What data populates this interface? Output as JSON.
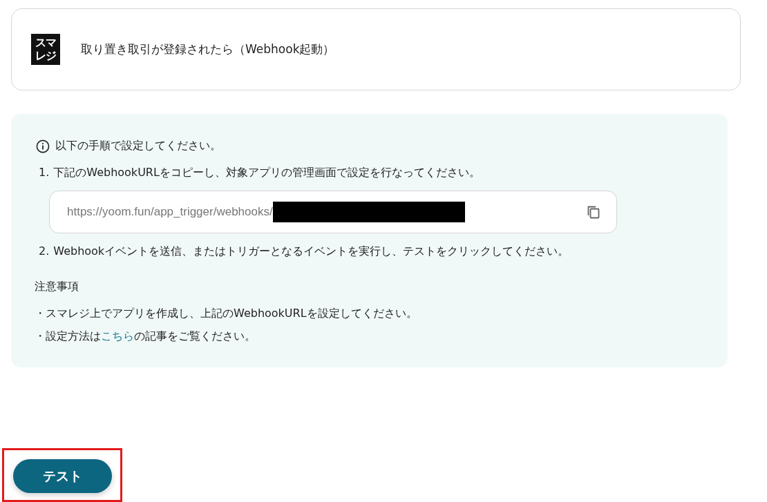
{
  "trigger": {
    "logo_text": "スマレジ",
    "title": "取り置き取引が登録されたら（Webhook起動）"
  },
  "instructions": {
    "heading": "以下の手順で設定してください。",
    "steps": [
      {
        "kind": "text",
        "number": "1.",
        "text": "下記のWebhookURLをコピーし、対象アプリの管理画面で設定を行なってください。"
      },
      {
        "kind": "url",
        "value": "https://yoom.fun/app_trigger/webhooks/",
        "redacted": true
      },
      {
        "kind": "text",
        "number": "2.",
        "text": "Webhookイベントを送信、またはトリガーとなるイベントを実行し、テストをクリックしてください。"
      }
    ],
    "notes_title": "注意事項",
    "notes": [
      {
        "text_before": "・スマレジ上でアプリを作成し、上記のWebhookURLを設定してください。"
      },
      {
        "text_before": "・設定方法は",
        "link": "こちら",
        "text_after": "の記事をご覧ください。"
      }
    ]
  },
  "test_button": {
    "label": "テスト",
    "highlighted": true
  }
}
